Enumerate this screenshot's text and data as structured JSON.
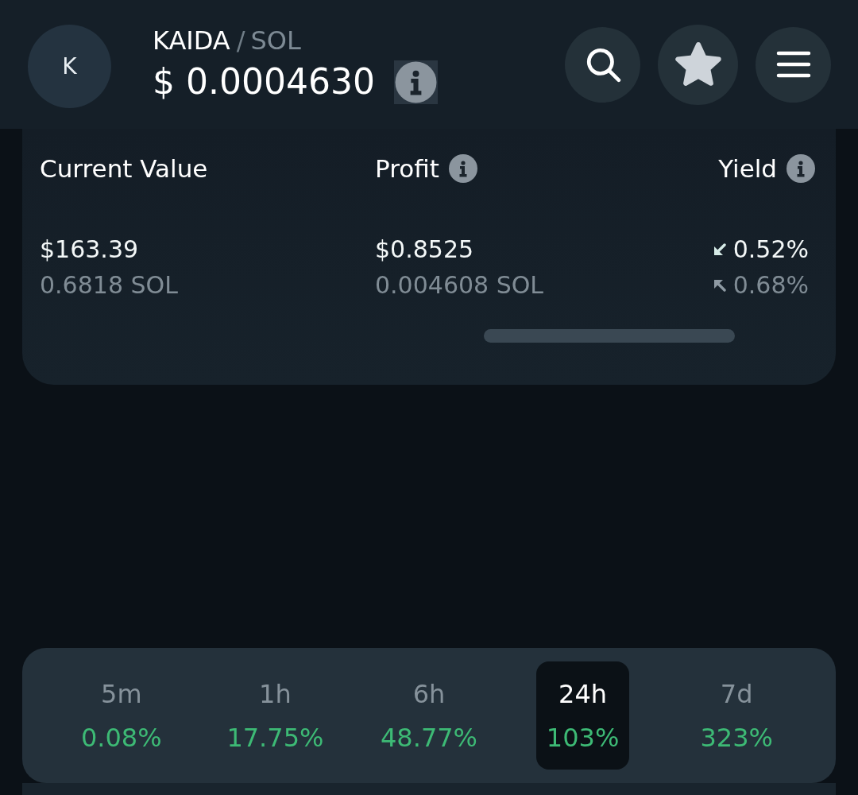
{
  "header": {
    "avatar": {
      "letter": "K"
    },
    "pair": {
      "base": "KAIDA",
      "separator": "/",
      "quote": "SOL"
    },
    "price": "$ 0.0004630",
    "price_info": true
  },
  "stats": {
    "columns": [
      {
        "label": "Current Value",
        "info": false,
        "lines": [
          {
            "kind": "plain",
            "text": "$163.39"
          },
          {
            "kind": "plain",
            "text": "0.6818 SOL"
          }
        ]
      },
      {
        "label": "Profit",
        "info": true,
        "lines": [
          {
            "kind": "plain",
            "text": "$0.8525"
          },
          {
            "kind": "plain",
            "text": "0.004608 SOL"
          }
        ]
      },
      {
        "label": "Yield",
        "info": true,
        "lines": [
          {
            "kind": "down",
            "text": "0.52%"
          },
          {
            "kind": "up",
            "text": "0.68%"
          }
        ]
      }
    ]
  },
  "timeframes": [
    {
      "label": "5m",
      "change": "0.08%",
      "selected": false
    },
    {
      "label": "1h",
      "change": "17.75%",
      "selected": false
    },
    {
      "label": "6h",
      "change": "48.77%",
      "selected": false
    },
    {
      "label": "24h",
      "change": "103%",
      "selected": true
    },
    {
      "label": "7d",
      "change": "323%",
      "selected": false
    }
  ]
}
